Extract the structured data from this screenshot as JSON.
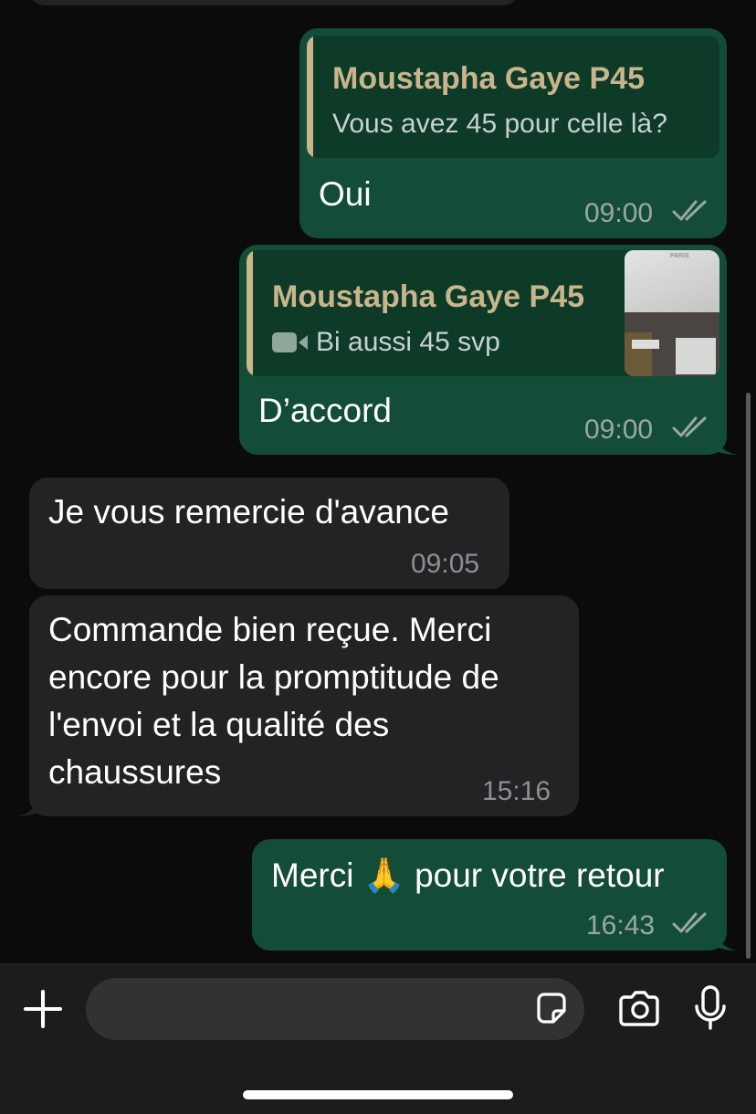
{
  "messages": [
    {
      "direction": "outgoing",
      "reply": {
        "name": "Moustapha Gaye P45",
        "text": "Vous avez 45 pour celle là?"
      },
      "text": "Oui",
      "time": "09:00",
      "status": "read"
    },
    {
      "direction": "outgoing",
      "reply": {
        "name": "Moustapha Gaye P45",
        "text": "Bi aussi 45 svp",
        "media": "video-icon",
        "thumb_label": "PARIS"
      },
      "text": "D’accord",
      "time": "09:00",
      "status": "read"
    },
    {
      "direction": "incoming",
      "text": "Je vous remercie d'avance",
      "time": "09:05"
    },
    {
      "direction": "incoming",
      "lines": [
        "Commande bien reçue. Merci",
        "encore pour la promptitude de",
        "l'envoi et la qualité des",
        "chaussures"
      ],
      "time": "15:16"
    },
    {
      "direction": "outgoing",
      "text": "Merci 🙏 pour votre retour",
      "time": "16:43",
      "status": "read"
    }
  ],
  "composer": {
    "attach_icon": "plus-icon",
    "sticker_icon": "sticker-icon",
    "camera_icon": "camera-icon",
    "mic_icon": "microphone-icon",
    "placeholder": ""
  },
  "colors": {
    "background": "#0b0b0b",
    "outgoing_bubble": "#144d37",
    "incoming_bubble": "#232325",
    "quote_name": "#c9b58c",
    "composer": "#1c1c1e"
  }
}
